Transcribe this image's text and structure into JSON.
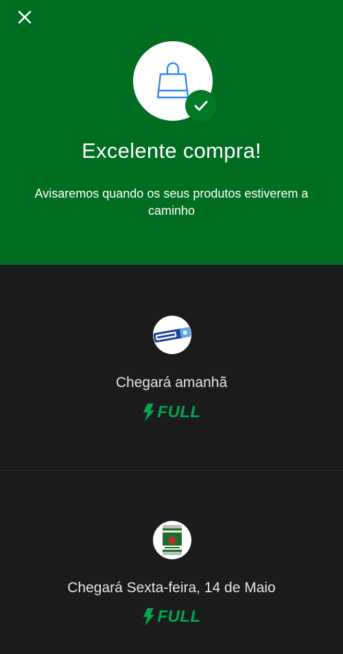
{
  "header": {
    "close_icon": "close-icon",
    "bag_icon": "shopping-bag-icon",
    "check_icon": "check-icon",
    "title": "Excelente compra!",
    "subtitle": "Avisaremos quando os seus produtos estiverem a caminho"
  },
  "shipments": [
    {
      "product_thumbnail": "negresco-biscuit-thumbnail",
      "eta": "Chegará amanhã",
      "shipping_badge": "FULL",
      "badge_icon": "lightning-bolt-icon"
    },
    {
      "product_thumbnail": "heineken-keg-thumbnail",
      "eta": "Chegará Sexta-feira, 14 de Maio",
      "shipping_badge": "FULL",
      "badge_icon": "lightning-bolt-icon"
    }
  ],
  "colors": {
    "header_bg": "#016d21",
    "body_bg": "#1b1b1b",
    "full_green": "#00a650",
    "bag_blue": "#3483fa"
  }
}
